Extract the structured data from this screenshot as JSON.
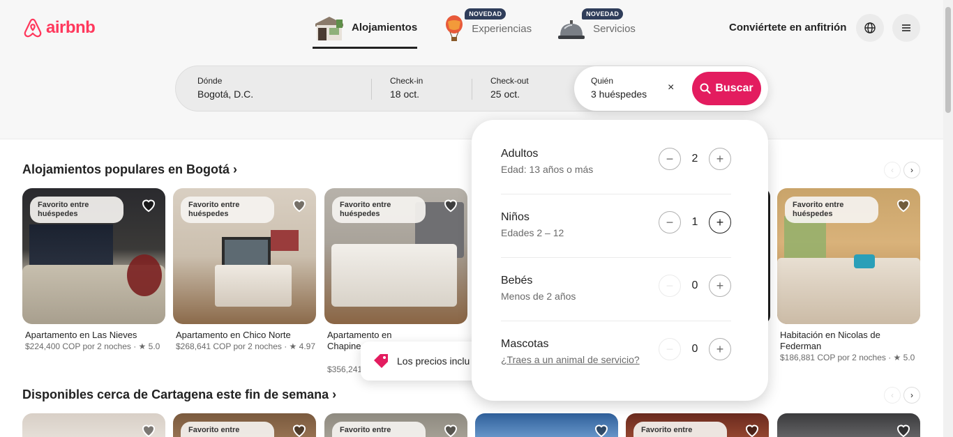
{
  "header": {
    "brand": "airbnb",
    "nav": [
      {
        "label": "Alojamientos",
        "badge": "",
        "active": true
      },
      {
        "label": "Experiencias",
        "badge": "NOVEDAD",
        "active": false
      },
      {
        "label": "Servicios",
        "badge": "NOVEDAD",
        "active": false
      }
    ],
    "host_link": "Conviértete en anfitrión"
  },
  "search": {
    "where_label": "Dónde",
    "where_value": "Bogotá, D.C.",
    "checkin_label": "Check-in",
    "checkin_value": "18 oct.",
    "checkout_label": "Check-out",
    "checkout_value": "25 oct.",
    "who_label": "Quién",
    "who_value": "3 huéspedes",
    "clear": "×",
    "button": "Buscar"
  },
  "section1": {
    "title": "Alojamientos populares en Bogotá ›",
    "cards": [
      {
        "badge": "Favorito entre huéspedes",
        "title": "Apartamento en Las Nieves",
        "meta": "$224,400 COP por 2 noches · ★ 5.0"
      },
      {
        "badge": "Favorito entre huéspedes",
        "title": "Apartamento en Chico Norte",
        "meta": "$268,641 COP por 2 noches · ★ 4.97"
      },
      {
        "badge": "Favorito entre huéspedes",
        "title": "Apartamento en Chapine",
        "meta": "$356,241"
      },
      {
        "badge": "Favorito entre huéspedes",
        "title": "Habitación en Nicolas de Federman",
        "meta": "$186,881 COP por 2 noches · ★ 5.0"
      }
    ]
  },
  "section2": {
    "title": "Disponibles cerca de Cartagena este fin de semana ›",
    "badges": [
      "Favorito entre",
      "Favorito entre",
      "Favorito entre"
    ]
  },
  "toast": {
    "text": "Los precios inclu"
  },
  "guests": [
    {
      "label": "Adultos",
      "sub": "Edad: 13 años o más",
      "value": "2"
    },
    {
      "label": "Niños",
      "sub": "Edades 2 – 12",
      "value": "1"
    },
    {
      "label": "Bebés",
      "sub": "Menos de 2 años",
      "value": "0"
    },
    {
      "label": "Mascotas",
      "sub": "¿Traes a un animal de servicio?",
      "value": "0"
    }
  ],
  "colors": {
    "brand": "#ff385c",
    "search_button": "#e31c5f",
    "badge_bg": "#2f3d5a"
  }
}
